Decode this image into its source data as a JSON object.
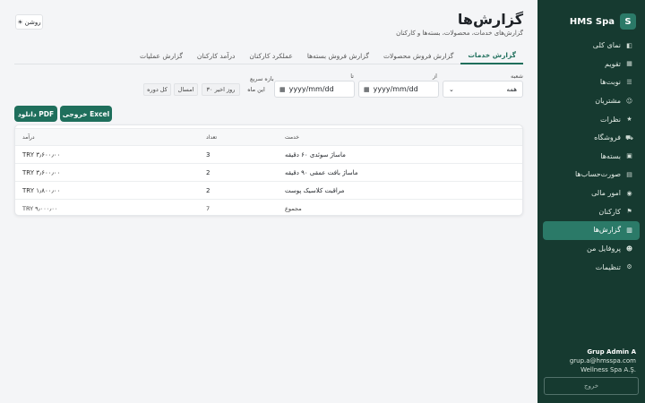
{
  "brand": {
    "logo": "S",
    "name": "HMS Spa"
  },
  "sidebar": {
    "items": [
      {
        "label": "نمای کلی",
        "icon": "dashboard-icon",
        "glyph": "◧"
      },
      {
        "label": "تقویم",
        "icon": "calendar-icon",
        "glyph": "▦"
      },
      {
        "label": "نوبت‌ها",
        "icon": "list-icon",
        "glyph": "☰"
      },
      {
        "label": "مشتریان",
        "icon": "customers-icon",
        "glyph": "☺"
      },
      {
        "label": "نظرات",
        "icon": "star-icon",
        "glyph": "★"
      },
      {
        "label": "فروشگاه",
        "icon": "cart-icon",
        "glyph": "⛟"
      },
      {
        "label": "بسته‌ها",
        "icon": "package-icon",
        "glyph": "▣"
      },
      {
        "label": "صورت‌حساب‌ها",
        "icon": "invoice-icon",
        "glyph": "▤"
      },
      {
        "label": "امور مالی",
        "icon": "money-bag-icon",
        "glyph": "◉"
      },
      {
        "label": "کارکنان",
        "icon": "flag-icon",
        "glyph": "⚑"
      },
      {
        "label": "گزارش‌ها",
        "icon": "chart-icon",
        "glyph": "▥"
      },
      {
        "label": "پروفایل من",
        "icon": "user-icon",
        "glyph": "☻"
      },
      {
        "label": "تنظیمات",
        "icon": "gear-icon",
        "glyph": "⚙"
      }
    ],
    "active_index": 10
  },
  "user": {
    "name": "Grup Admin A",
    "email": "grup.a@hmsspa.com",
    "company": "Wellness Spa A.Ş."
  },
  "logout_label": "خروج",
  "header": {
    "title": "گزارش‌ها",
    "subtitle": "گزارش‌های خدمات، محصولات، بسته‌ها و کارکنان",
    "theme_label": "روشن",
    "theme_glyph": "☀"
  },
  "tabs": [
    "گزارش خدمات",
    "گزارش فروش محصولات",
    "گزارش فروش بسته‌ها",
    "عملکرد کارکنان",
    "درآمد کارکنان",
    "گزارش عملیات"
  ],
  "filters": {
    "branch_label": "شعبه",
    "branch_value": "همه",
    "from_label": "از",
    "from_placeholder": "yyyy/mm/dd",
    "to_label": "تا",
    "to_placeholder": "yyyy/mm/dd",
    "quick_label": "بازه سریع",
    "quick": [
      "این ماه",
      "۳۰ روز اخیر",
      "امسال",
      "کل دوره"
    ]
  },
  "actions": {
    "excel": "خروجی Excel",
    "pdf": "دانلود PDF"
  },
  "table": {
    "headers": [
      "خدمت",
      "تعداد",
      "درآمد"
    ],
    "rows": [
      {
        "service": "ماساژ سوئدی ۶۰ دقیقه",
        "count": "3",
        "revenue": "TRY ۳٫۶۰۰٫۰۰"
      },
      {
        "service": "ماساژ بافت عمقی ۹۰ دقیقه",
        "count": "2",
        "revenue": "TRY ۳٫۶۰۰٫۰۰"
      },
      {
        "service": "مراقبت کلاسیک پوست",
        "count": "2",
        "revenue": "TRY ۱٫۸۰۰٫۰۰"
      }
    ],
    "total": {
      "label": "مجموع",
      "count": "7",
      "revenue": "TRY ۹٫۰۰۰٫۰۰"
    }
  }
}
